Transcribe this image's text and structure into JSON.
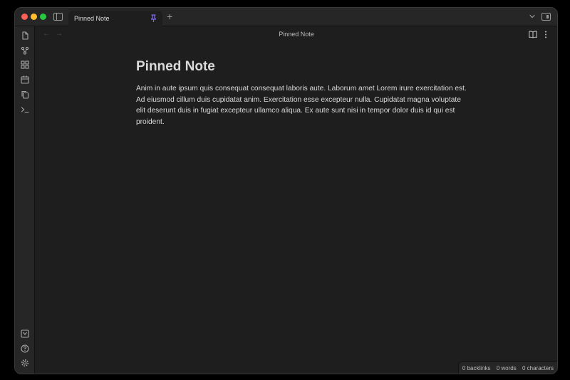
{
  "titlebar": {
    "tab_label": "Pinned Note",
    "new_tab_glyph": "+"
  },
  "ribbon": {
    "top_icons": [
      "files-icon",
      "graph-icon",
      "canvas-icon",
      "calendar-icon",
      "copy-icon",
      "terminal-icon"
    ],
    "bottom_icons": [
      "vault-icon",
      "help-icon",
      "settings-icon"
    ]
  },
  "editor": {
    "back_glyph": "←",
    "forward_glyph": "→",
    "view_title": "Pinned Note",
    "note_title": "Pinned Note",
    "note_body": "Anim in aute ipsum quis consequat consequat laboris aute. Laborum amet Lorem irure exercitation est. Ad eiusmod cillum duis cupidatat anim. Exercitation esse excepteur nulla. Cupidatat magna voluptate elit deserunt duis in fugiat excepteur ullamco aliqua. Ex aute sunt nisi in tempor dolor duis id qui est proident."
  },
  "status_bar": {
    "backlinks": "0 backlinks",
    "words": "0 words",
    "characters": "0 characters"
  },
  "colors": {
    "pin_accent": "#7b6cf0",
    "background": "#1e1e1e",
    "chrome": "#262626"
  }
}
